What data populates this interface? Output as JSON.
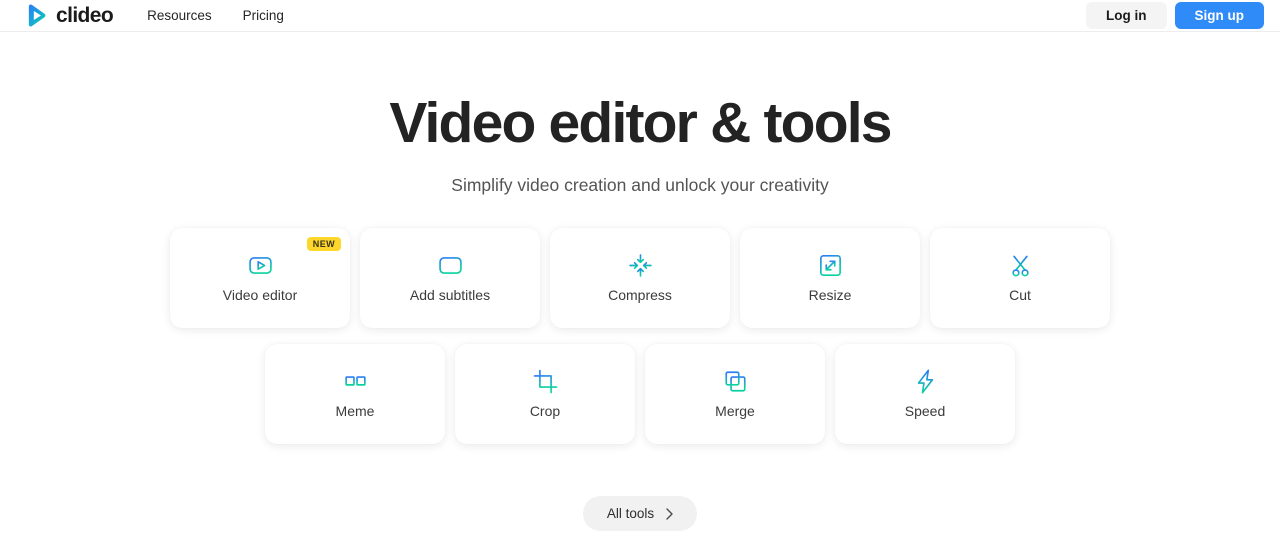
{
  "header": {
    "brand": {
      "name": "clideo",
      "icon": "play-logo-icon"
    },
    "nav": [
      {
        "label": "Resources",
        "name": "nav-link-resources"
      },
      {
        "label": "Pricing",
        "name": "nav-link-pricing"
      }
    ],
    "login_label": "Log in",
    "signup_label": "Sign up",
    "signup_color": "#2e8bf8",
    "login_bg": "#f4f4f5"
  },
  "hero": {
    "title": "Video editor & tools",
    "subtitle": "Simplify video creation and unlock your creativity"
  },
  "tools": {
    "badge_new_label": "NEW",
    "badge_new_color": "#fcd62b",
    "gradient_from": "#2b7cf6",
    "gradient_to": "#0ad39f",
    "rows": [
      [
        {
          "label": "Video editor",
          "icon": "video-editor-icon",
          "badge": "NEW"
        },
        {
          "label": "Add subtitles",
          "icon": "subtitles-icon",
          "badge": null
        },
        {
          "label": "Compress",
          "icon": "compress-icon",
          "badge": null
        },
        {
          "label": "Resize",
          "icon": "resize-icon",
          "badge": null
        },
        {
          "label": "Cut",
          "icon": "cut-scissors-icon",
          "badge": null
        }
      ],
      [
        {
          "label": "Meme",
          "icon": "meme-glasses-icon",
          "badge": null
        },
        {
          "label": "Crop",
          "icon": "crop-icon",
          "badge": null
        },
        {
          "label": "Merge",
          "icon": "merge-squares-icon",
          "badge": null
        },
        {
          "label": "Speed",
          "icon": "speed-bolt-icon",
          "badge": null
        }
      ]
    ]
  },
  "footer_cta": {
    "label": "All tools",
    "icon": "chevron-right-icon"
  }
}
